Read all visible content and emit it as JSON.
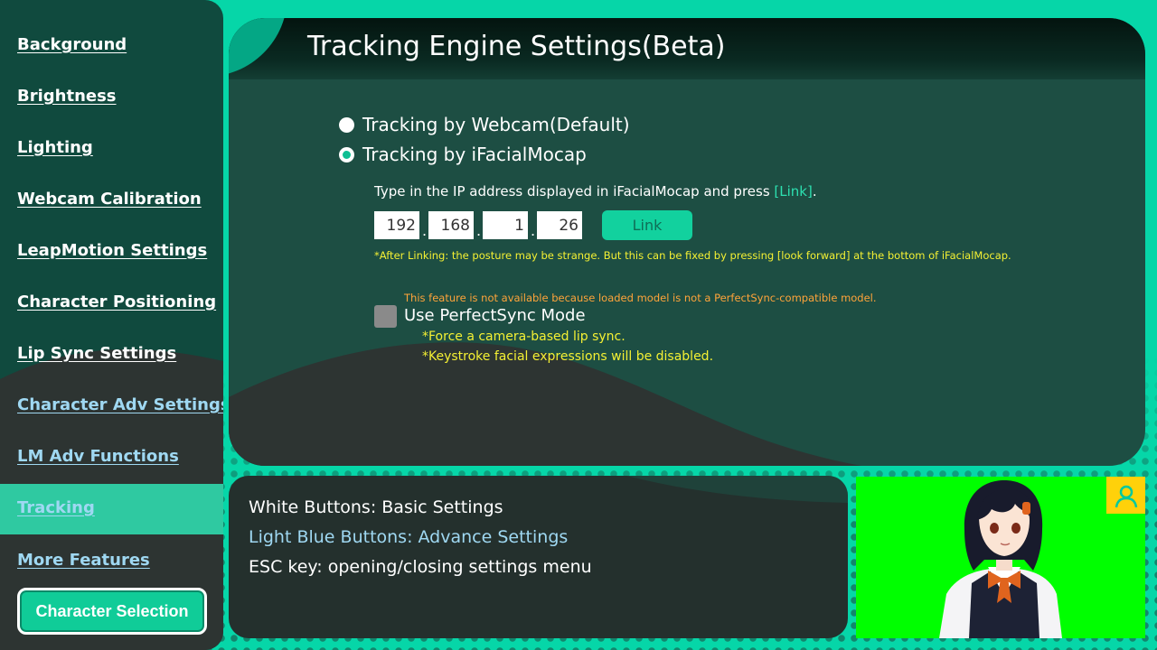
{
  "sidebar": {
    "items": [
      {
        "label": "Background",
        "type": "basic"
      },
      {
        "label": "Brightness",
        "type": "basic"
      },
      {
        "label": "Lighting",
        "type": "basic"
      },
      {
        "label": "Webcam Calibration",
        "type": "basic"
      },
      {
        "label": "LeapMotion Settings",
        "type": "basic"
      },
      {
        "label": "Character Positioning",
        "type": "basic"
      },
      {
        "label": "Lip Sync Settings",
        "type": "basic"
      },
      {
        "label": "Character Adv Settings",
        "type": "advanced"
      },
      {
        "label": "LM Adv Functions",
        "type": "advanced"
      },
      {
        "label": "Tracking",
        "type": "advanced",
        "active": true
      },
      {
        "label": "More Features",
        "type": "advanced"
      }
    ],
    "character_button": "Character Selection"
  },
  "main": {
    "title": "Tracking Engine Settings(Beta)",
    "tracking_options": [
      {
        "label": "Tracking by Webcam(Default)",
        "selected": false
      },
      {
        "label": "Tracking by iFacialMocap",
        "selected": true
      }
    ],
    "instruction_prefix": "Type in the IP address displayed in iFacialMocap and press ",
    "instruction_link": "[Link]",
    "instruction_suffix": ".",
    "ip": [
      "192",
      "168",
      "1",
      "26"
    ],
    "ip_separator": ".",
    "link_button": "Link",
    "after_link_note": "*After Linking: the posture may be strange. But this can be fixed by pressing [look forward] at the bottom of iFacialMocap.",
    "perfectsync_warning": "This feature is not available because loaded model is not a PerfectSync-compatible model.",
    "perfectsync_label": "Use PerfectSync Mode",
    "perfectsync_checked": false,
    "perfectsync_notes": [
      "*Force a camera-based lip sync.",
      "*Keystroke facial expressions will be disabled."
    ]
  },
  "info": {
    "lines": [
      "White Buttons: Basic Settings",
      "Light Blue Buttons: Advance Settings",
      "ESC key: opening/closing settings menu"
    ]
  },
  "preview": {
    "icon": "person-silhouette-icon",
    "background_color": "#00ff00"
  },
  "colors": {
    "accent": "#06d6a8",
    "basic_text": "#ffffff",
    "advanced_text": "#9fd8f2",
    "note_yellow": "#f4f033",
    "warning_orange": "#ffa43a"
  }
}
